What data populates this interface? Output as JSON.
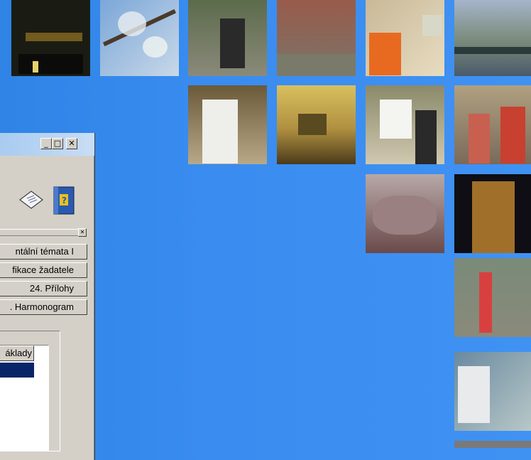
{
  "window": {
    "tabs": [
      "ntální témata I",
      "fikace žadatele",
      "24. Přílohy",
      ". Harmonogram"
    ],
    "list_header": "áklady",
    "titlebar_buttons": [
      "minimize-icon",
      "maximize-icon",
      "close-icon"
    ]
  },
  "colors": {
    "desktop": "#3a8cf0",
    "window_face": "#d4d0c8",
    "selection": "#0a246a"
  }
}
